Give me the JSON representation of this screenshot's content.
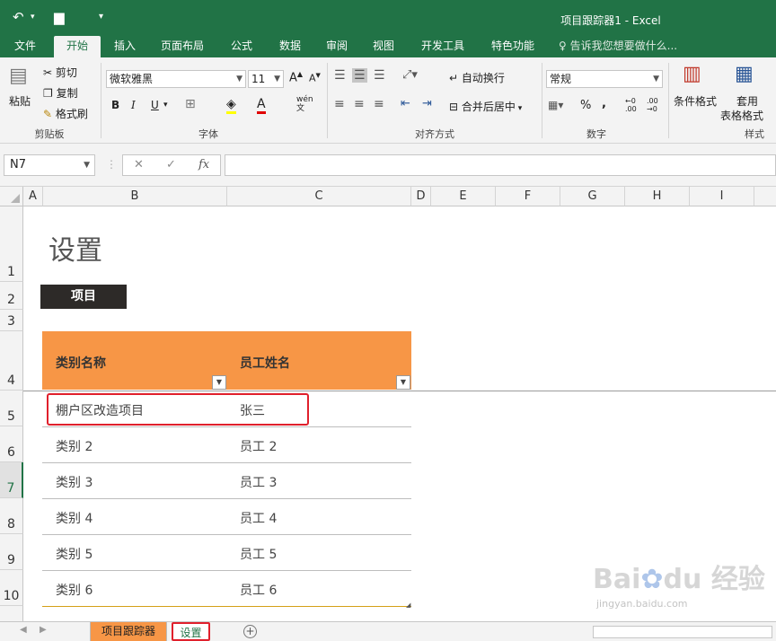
{
  "window": {
    "title": "项目跟踪器1 - Excel"
  },
  "ribbon_tabs": [
    "文件",
    "开始",
    "插入",
    "页面布局",
    "公式",
    "数据",
    "审阅",
    "视图",
    "开发工具",
    "特色功能"
  ],
  "tell_me": "告诉我您想要做什么...",
  "clipboard": {
    "paste": "粘贴",
    "cut": "剪切",
    "copy": "复制",
    "format_painter": "格式刷",
    "label": "剪贴板"
  },
  "font": {
    "name": "微软雅黑",
    "size": "11",
    "label": "字体",
    "bold": "B",
    "italic": "I",
    "underline": "U"
  },
  "alignment": {
    "wrap": "自动换行",
    "merge": "合并后居中",
    "label": "对齐方式"
  },
  "number": {
    "format": "常规",
    "label": "数字",
    "percent": "%"
  },
  "styles": {
    "conditional": "条件格式",
    "table_1": "套用",
    "table_2": "表格格式",
    "label": "样式"
  },
  "formula_bar": {
    "name_box": "N7",
    "cancel": "✕",
    "enter": "✓",
    "fx": "fx"
  },
  "columns": [
    "A",
    "B",
    "C",
    "D",
    "E",
    "F",
    "G",
    "H",
    "I"
  ],
  "rows": [
    "1",
    "2",
    "3",
    "4",
    "5",
    "6",
    "7",
    "8",
    "9",
    "10"
  ],
  "sheet": {
    "title": "设置",
    "section_label": "项目",
    "headers": [
      "类别名称",
      "员工姓名"
    ],
    "data_rows": [
      [
        "棚户区改造项目",
        "张三"
      ],
      [
        "类别 2",
        "员工 2"
      ],
      [
        "类别 3",
        "员工 3"
      ],
      [
        "类别 4",
        "员工 4"
      ],
      [
        "类别 5",
        "员工 5"
      ],
      [
        "类别 6",
        "员工 6"
      ]
    ]
  },
  "sheet_tabs": [
    "项目跟踪器",
    "设置"
  ],
  "colors": {
    "excel_green": "#217346",
    "table_header": "#f79646",
    "highlight": "#e0202c"
  }
}
